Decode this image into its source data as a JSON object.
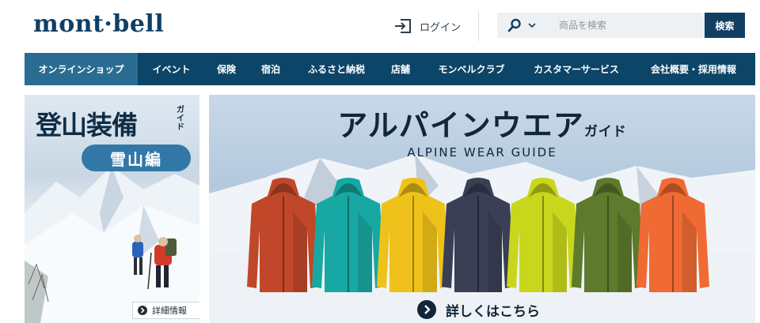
{
  "header": {
    "logo_text": "mont·bell",
    "login_label": "ログイン"
  },
  "search": {
    "placeholder": "商品を検索",
    "button_label": "検索"
  },
  "nav": {
    "items": [
      {
        "label": "オンラインショップ",
        "active": true
      },
      {
        "label": "イベント"
      },
      {
        "label": "保険"
      },
      {
        "label": "宿泊"
      },
      {
        "label": "ふるさと納税"
      },
      {
        "label": "店舗"
      },
      {
        "label": "モンベルクラブ"
      },
      {
        "label": "カスタマーサービス"
      },
      {
        "label": "会社概要・採用情報"
      }
    ]
  },
  "promo_left": {
    "title": "登山装備",
    "guide": "ガイド",
    "pill": "雪山編",
    "detail_label": "詳細情報"
  },
  "banner": {
    "title_main": "アルパインウエア",
    "title_small": "ガイド",
    "subtitle": "ALPINE WEAR GUIDE",
    "more_label": "詳しくはこちら",
    "jacket_colors": [
      "#c0472a",
      "#17a8a3",
      "#eec21a",
      "#3a3f55",
      "#c8d71c",
      "#5d7a2d",
      "#f06a34"
    ]
  },
  "colors": {
    "brand": "#0f3f66",
    "nav_bg": "#0c4567",
    "nav_active": "#2a6c92"
  }
}
